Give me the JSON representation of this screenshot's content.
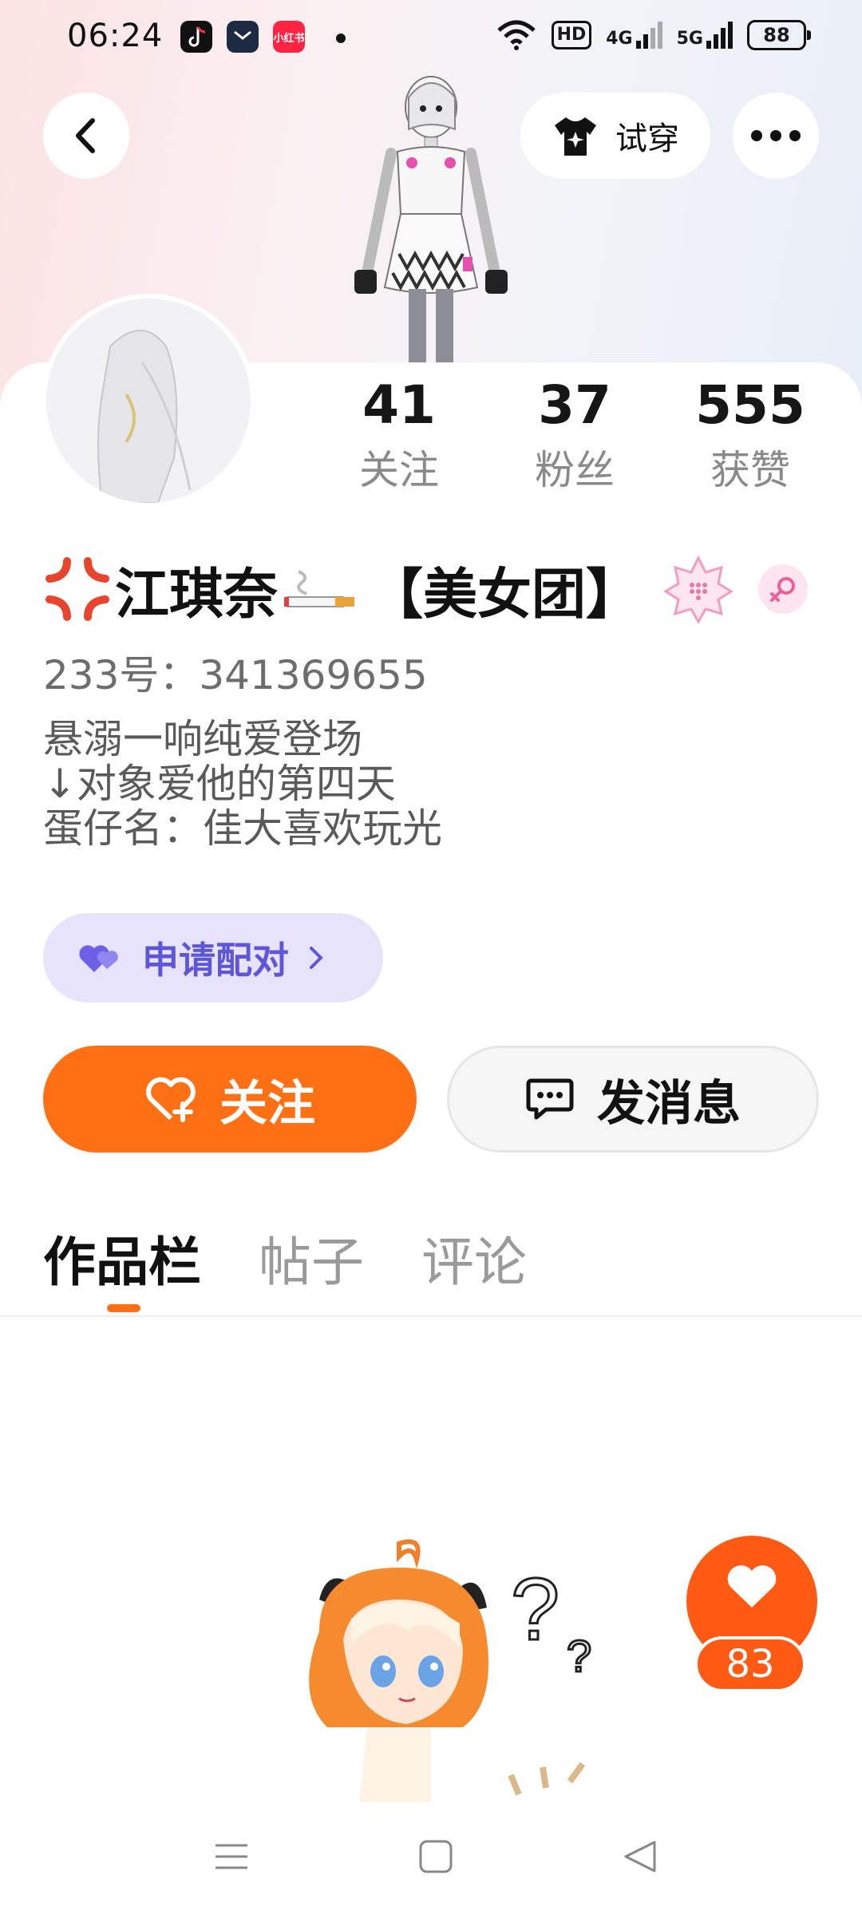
{
  "status_bar": {
    "time": "06:24",
    "app_icon_xhs": "小红书",
    "hd_badge": "HD",
    "net_4g": "4G",
    "net_5g": "5G",
    "battery": "88"
  },
  "header": {
    "try_on_label": "试穿"
  },
  "stats": [
    {
      "value": "41",
      "label": "关注"
    },
    {
      "value": "37",
      "label": "粉丝"
    },
    {
      "value": "555",
      "label": "获赞"
    }
  ],
  "profile": {
    "name_main": "江琪奈",
    "name_suffix": "【美女团】",
    "uid": "233号：341369655",
    "bio": [
      "悬溺一响纯爱登场",
      "↓对象爱他的第四天",
      "蛋仔名：佳大喜欢玩光"
    ]
  },
  "actions": {
    "pair_label": "申请配对",
    "follow_label": "关注",
    "message_label": "发消息"
  },
  "tabs": [
    {
      "label": "作品栏",
      "active": true
    },
    {
      "label": "帖子",
      "active": false
    },
    {
      "label": "评论",
      "active": false
    }
  ],
  "like_fab": {
    "count": "83"
  },
  "colors": {
    "accent_orange": "#ff7014",
    "pair_purple": "#5e55d9",
    "pair_bg": "#e7e3fb"
  },
  "icons": [
    "back-icon",
    "tshirt-icon",
    "more-icon",
    "heart-plus-icon",
    "chat-icon",
    "double-heart-icon",
    "chevron-right-icon",
    "heart-icon",
    "menu-icon",
    "home-icon",
    "back-triangle-icon"
  ]
}
